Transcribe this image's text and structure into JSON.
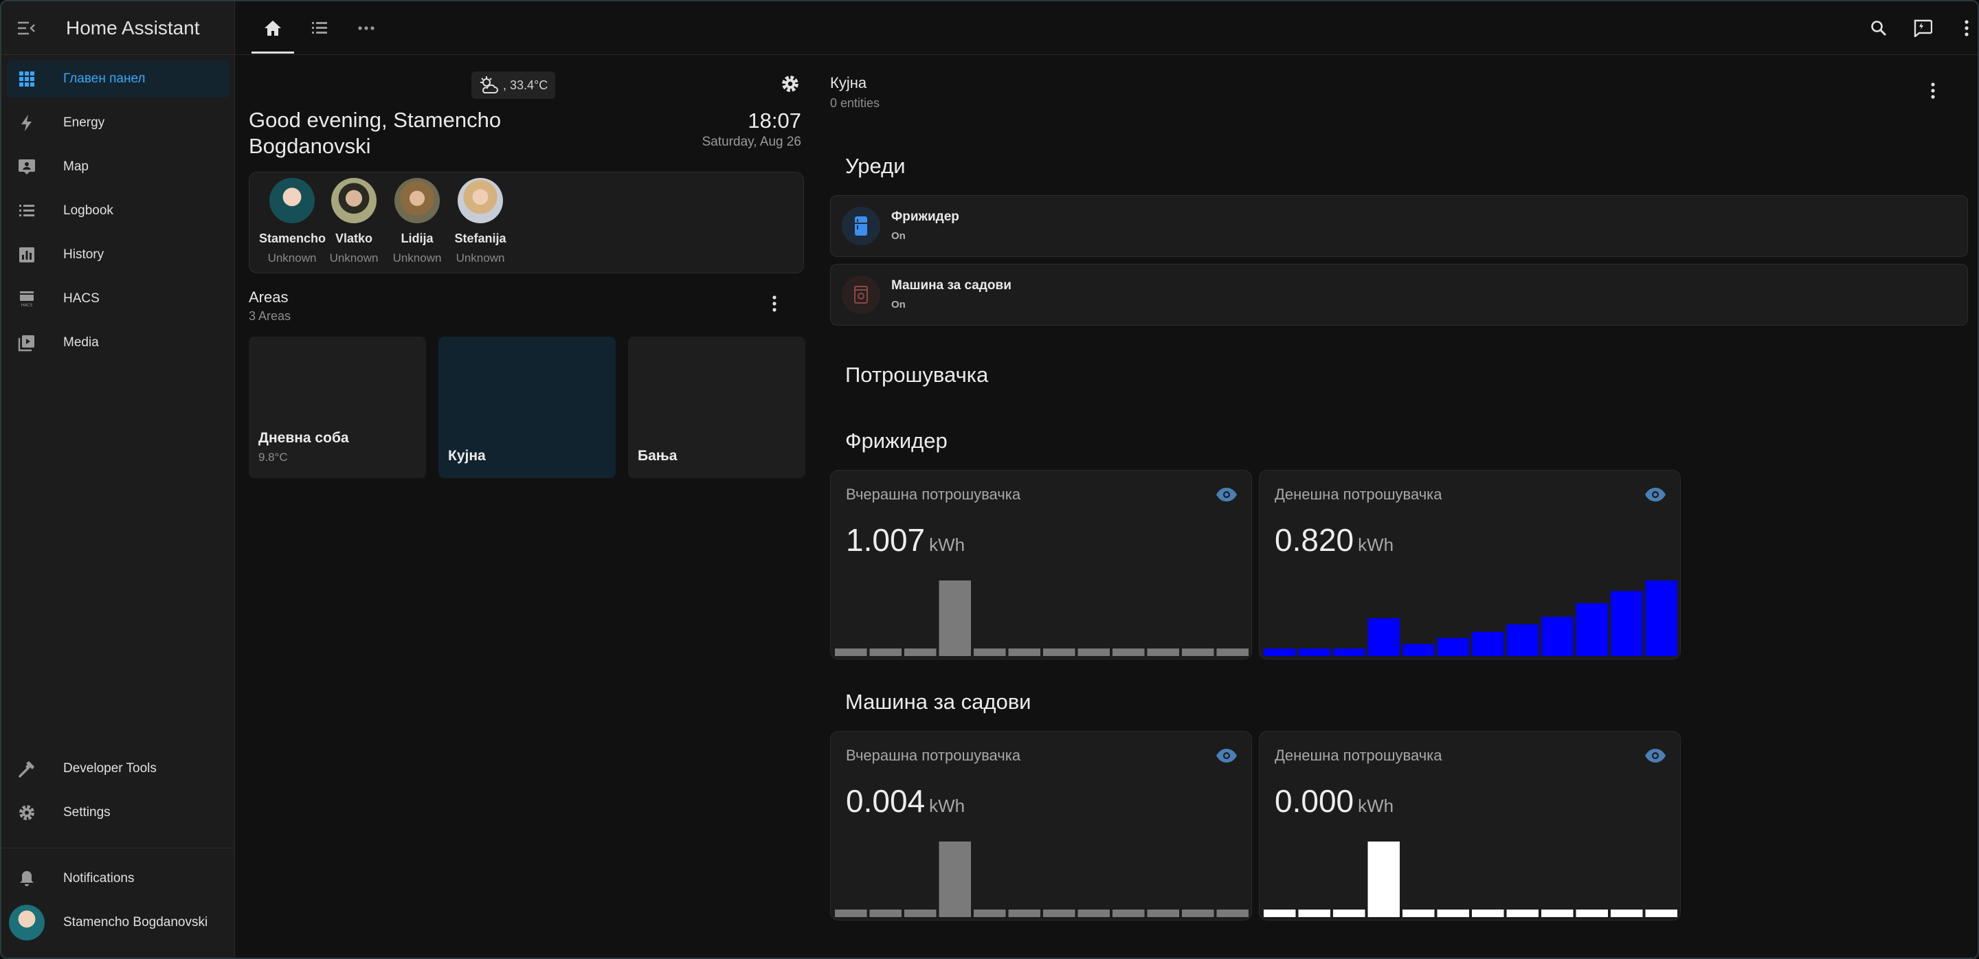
{
  "app_title": "Home Assistant",
  "colors": {
    "accent": "#39a7f4",
    "bar_grey": "#7a7a7a",
    "bar_blue": "#0000ff",
    "bar_white": "#ffffff"
  },
  "sidebar": {
    "menu_icon": "menu-collapse-icon",
    "items": [
      {
        "label": "Главен панел",
        "icon": "grid-icon",
        "active": true
      },
      {
        "label": "Energy",
        "icon": "lightning-icon"
      },
      {
        "label": "Map",
        "icon": "map-icon"
      },
      {
        "label": "Logbook",
        "icon": "list-icon"
      },
      {
        "label": "History",
        "icon": "chart-icon"
      },
      {
        "label": "HACS",
        "icon": "hacs-icon"
      },
      {
        "label": "Media",
        "icon": "media-icon"
      }
    ],
    "bottom_items": [
      {
        "label": "Developer Tools",
        "icon": "hammer-icon"
      },
      {
        "label": "Settings",
        "icon": "gear-icon"
      }
    ],
    "notifications_label": "Notifications",
    "user_name": "Stamencho Bogdanovski"
  },
  "topbar": {
    "tabs": [
      "home-icon",
      "list-icon",
      "more-icon"
    ],
    "actions": [
      "search-icon",
      "assist-icon",
      "overflow-menu-icon"
    ]
  },
  "home": {
    "weather": ", 33.4°C",
    "greeting": "Good evening, Stamencho Bogdanovski",
    "time": "18:07",
    "date": "Saturday, Aug 26",
    "people": [
      {
        "name": "Stamencho",
        "state": "Unknown"
      },
      {
        "name": "Vlatko",
        "state": "Unknown"
      },
      {
        "name": "Lidija",
        "state": "Unknown"
      },
      {
        "name": "Stefanija",
        "state": "Unknown"
      }
    ],
    "areas_title": "Areas",
    "areas_sub": "3 Areas",
    "areas": [
      {
        "name": "Дневна соба",
        "temp": "9.8°C"
      },
      {
        "name": "Кујна",
        "temp": ""
      },
      {
        "name": "Бања",
        "temp": ""
      }
    ]
  },
  "area_view": {
    "title": "Кујна",
    "subtitle": "0 entities",
    "devices_heading": "Уреди",
    "devices": [
      {
        "name": "Фрижидер",
        "state": "On"
      },
      {
        "name": "Машина за садови",
        "state": "On"
      }
    ],
    "consumption_heading": "Потрошувачка",
    "groups": [
      {
        "heading": "Фрижидер",
        "stats": [
          {
            "label": "Вчерашна потрошувачка",
            "value": "1.007",
            "unit": "kWh",
            "bar_color": "#7a7a7a",
            "bars": [
              0.1,
              0.1,
              0.1,
              1.0,
              0.1,
              0.1,
              0.1,
              0.1,
              0.1,
              0.1,
              0.1,
              0.1
            ]
          },
          {
            "label": "Денешна потрошувачка",
            "value": "0.820",
            "unit": "kWh",
            "bar_color": "#0000ff",
            "bars": [
              0.1,
              0.1,
              0.1,
              0.5,
              0.16,
              0.24,
              0.32,
              0.42,
              0.52,
              0.7,
              0.86,
              1.0
            ]
          }
        ]
      },
      {
        "heading": "Машина за садови",
        "stats": [
          {
            "label": "Вчерашна потрошувачка",
            "value": "0.004",
            "unit": "kWh",
            "bar_color": "#7a7a7a",
            "bars": [
              0.1,
              0.1,
              0.1,
              1.0,
              0.1,
              0.1,
              0.1,
              0.1,
              0.1,
              0.1,
              0.1,
              0.1
            ]
          },
          {
            "label": "Денешна потрошувачка",
            "value": "0.000",
            "unit": "kWh",
            "bar_color": "#ffffff",
            "bars": [
              0.1,
              0.1,
              0.1,
              1.0,
              0.1,
              0.1,
              0.1,
              0.1,
              0.1,
              0.1,
              0.1,
              0.1
            ]
          }
        ]
      }
    ]
  }
}
